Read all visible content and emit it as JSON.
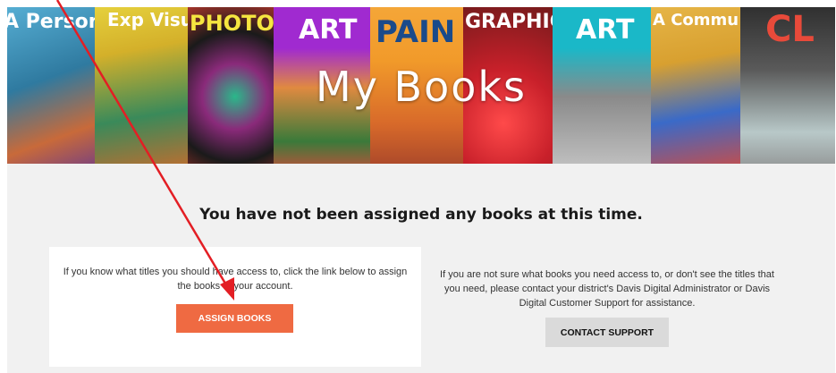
{
  "hero": {
    "title": "My Books",
    "covers": [
      {
        "label": "A Person",
        "color": "#4aa3c8"
      },
      {
        "label": "Exp Visual",
        "color": "#e6d23a"
      },
      {
        "label": "PHOTOG",
        "color": "#c63a2e"
      },
      {
        "label": "ART",
        "color": "#a02ad0"
      },
      {
        "label": "PAIN",
        "color": "#f19a2a"
      },
      {
        "label": "GRAPHIC",
        "color": "#c8202a"
      },
      {
        "label": "ART",
        "color": "#1ab8c8"
      },
      {
        "label": "A Commu",
        "color": "#d8a030"
      },
      {
        "label": "CL",
        "color": "#6a6a6a"
      }
    ]
  },
  "content": {
    "headline": "You have not been assigned any books at this time.",
    "left_text": "If you know what titles you should have access to, click the link below to assign the books to your account.",
    "assign_label": "ASSIGN BOOKS",
    "right_text": "If you are not sure what books you need access to, or don't see the titles that you need, please contact your district's Davis Digital Administrator or Davis Digital Customer Support for assistance.",
    "contact_label": "CONTACT SUPPORT"
  },
  "colors": {
    "accent": "#ef6a42",
    "annotation": "#e31e24"
  }
}
